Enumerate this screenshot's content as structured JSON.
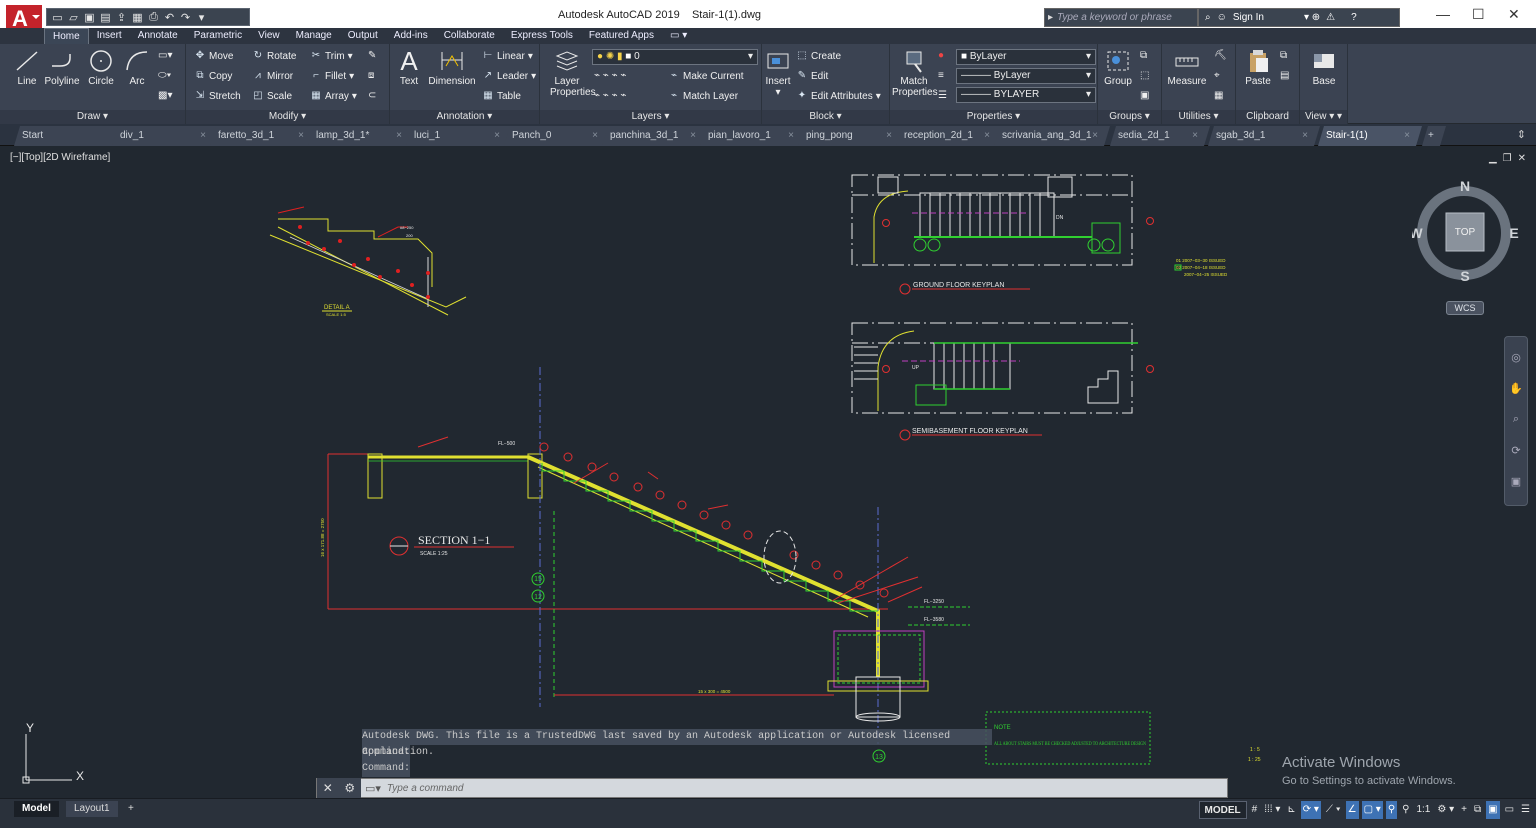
{
  "app": {
    "title": "Autodesk AutoCAD 2019",
    "file": "Stair-1(1).dwg",
    "logo": "A"
  },
  "search": {
    "placeholder": "Type a keyword or phrase"
  },
  "account": {
    "sign_in": "Sign In"
  },
  "window": {
    "minimize": "—",
    "maximize": "☐",
    "close": "✕"
  },
  "ribbon_tabs": [
    "Home",
    "Insert",
    "Annotate",
    "Parametric",
    "View",
    "Manage",
    "Output",
    "Add-ins",
    "Collaborate",
    "Express Tools",
    "Featured Apps"
  ],
  "ribbon": {
    "draw": {
      "title": "Draw",
      "line": "Line",
      "polyline": "Polyline",
      "circle": "Circle",
      "arc": "Arc"
    },
    "modify": {
      "title": "Modify",
      "move": "Move",
      "rotate": "Rotate",
      "trim": "Trim",
      "copy": "Copy",
      "mirror": "Mirror",
      "fillet": "Fillet",
      "stretch": "Stretch",
      "scale": "Scale",
      "array": "Array"
    },
    "annotation": {
      "title": "Annotation",
      "text": "Text",
      "dimension": "Dimension",
      "linear": "Linear",
      "leader": "Leader",
      "table": "Table"
    },
    "layers": {
      "title": "Layers",
      "layer_properties": "Layer Properties",
      "current_layer": "0",
      "make_current": "Make Current",
      "match_layer": "Match Layer"
    },
    "block": {
      "title": "Block",
      "insert": "Insert",
      "create": "Create",
      "edit": "Edit",
      "edit_attributes": "Edit Attributes"
    },
    "properties": {
      "title": "Properties",
      "match_properties": "Match Properties",
      "color": "ByLayer",
      "linetype": "ByLayer",
      "lineweight": "BYLAYER"
    },
    "groups": {
      "title": "Groups",
      "group": "Group"
    },
    "utilities": {
      "title": "Utilities",
      "measure": "Measure"
    },
    "clipboard": {
      "title": "Clipboard",
      "paste": "Paste"
    },
    "view": {
      "title": "View",
      "base": "Base"
    }
  },
  "file_tabs": [
    "Start",
    "div_1",
    "faretto_3d_1",
    "lamp_3d_1*",
    "luci_1",
    "Panch_0",
    "panchina_3d_1",
    "pian_lavoro_1",
    "ping_pong",
    "reception_2d_1",
    "scrivania_ang_3d_1",
    "sedia_2d_1",
    "sgab_3d_1",
    "Stair-1(1)"
  ],
  "viewport": {
    "label": "[−][Top][2D Wireframe]",
    "viewcube": {
      "n": "N",
      "s": "S",
      "e": "E",
      "w": "W",
      "top": "TOP"
    },
    "wcs": "WCS"
  },
  "drawing": {
    "section_title": "SECTION 1−1",
    "section_scale": "SCALE 1:25",
    "ground_keyplan": "GROUND FLOOR KEYPLAN",
    "semibasement_keyplan": "SEMIBASEMENT FLOOR KEYPLAN",
    "detail": "DETAIL A",
    "detail_scale": "SCALE 1:5",
    "fl_top": "FL−500",
    "fl_a": "FL−3250",
    "fl_b": "FL−3580",
    "dim_bottom": "15 x 300 = 4500",
    "dim_side": "16 x 171.88 = 2750",
    "grid_15": "15",
    "grid_12": "12",
    "grid_13": "13",
    "issue_rows": [
      "01 2007−03−30 ISSUED",
      "02 2007−04−18 ISSUED",
      "2007−04−25 ISSUED"
    ],
    "note_label": "NOTE",
    "note_text": "ALL ABOUT STAIRS MUST BE CHECKED ADJUSTED TO ARCHITECTURE DESIGN",
    "scale_a": "1 : 5",
    "scale_b": "1 : 25",
    "dn": "DN",
    "up": "UP"
  },
  "command": {
    "history": [
      "Autodesk DWG.  This file is a TrustedDWG last saved by an Autodesk application or Autodesk licensed application.",
      "Command:",
      "Command:"
    ],
    "placeholder": "Type a command"
  },
  "layout_tabs": [
    "Model",
    "Layout1",
    "+"
  ],
  "status": {
    "model": "MODEL",
    "scale": "1:1"
  },
  "activate": {
    "title": "Activate Windows",
    "subtitle": "Go to Settings to activate Windows."
  }
}
